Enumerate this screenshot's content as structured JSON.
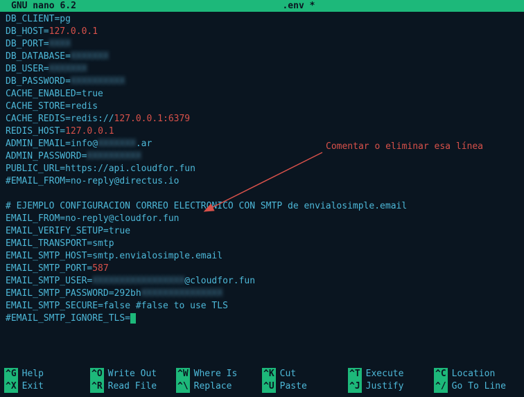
{
  "titlebar": {
    "app": "GNU nano 6.2",
    "file": ".env *"
  },
  "lines": {
    "l1_key": "DB_CLIENT",
    "l1_val": "pg",
    "l2_key": "DB_HOST",
    "l2_val": "127.0.0.1",
    "l3_key": "DB_PORT",
    "l3_blur": "XXXX",
    "l4_key": "DB_DATABASE",
    "l4_blur": "XXXXXXX",
    "l5_key": "DB_USER",
    "l5_blur": "XXXXXXX",
    "l6_key": "DB_PASSWORD",
    "l6_blur": "XXXXXXXXXX",
    "l7_key": "CACHE_ENABLED",
    "l7_val": "true",
    "l8_key": "CACHE_STORE",
    "l8_val": "redis",
    "l9_key": "CACHE_REDIS",
    "l9_val_a": "redis://",
    "l9_val_b": "127.0.0.1:6379",
    "l10_key": "REDIS_HOST",
    "l10_val": "127.0.0.1",
    "l11_key": "ADMIN_EMAIL",
    "l11_val_a": "info@",
    "l11_blur": "XXXXXXX",
    "l11_val_b": ".ar",
    "l12_key": "ADMIN_PASSWORD",
    "l12_blur": "XXXXXXXXXX",
    "l13_key": "PUBLIC_URL",
    "l13_val": "https://api.cloudfor.fun",
    "l14": "#EMAIL_FROM=no-reply@directus.io",
    "blank": " ",
    "l15": "# EJEMPLO CONFIGURACION CORREO ELECTRONICO CON SMTP de envialosimple.email",
    "l16_key": "EMAIL_FROM",
    "l16_val": "no-reply@cloudfor.fun",
    "l17_key": "EMAIL_VERIFY_SETUP",
    "l17_val": "true",
    "l18_key": "EMAIL_TRANSPORT",
    "l18_val": "smtp",
    "l19_key": "EMAIL_SMTP_HOST",
    "l19_val": "smtp.envialosimple.email",
    "l20_key": "EMAIL_SMTP_PORT",
    "l20_val": "587",
    "l21_key": "EMAIL_SMTP_USER",
    "l21_blur": "XXXXXXXXXXXXXXXXX",
    "l21_val": "@cloudfor.fun",
    "l22_key": "EMAIL_SMTP_PASSWORD",
    "l22_val_a": "292bh",
    "l22_blur": "XXXXXXXXXXXXXXX",
    "l23_key": "EMAIL_SMTP_SECURE",
    "l23_val": "false #false to use TLS",
    "l24": "#EMAIL_SMTP_IGNORE_TLS="
  },
  "annotation": "Comentar o eliminar esa línea",
  "help": {
    "r1c1_k": "^G",
    "r1c1_l": "Help",
    "r1c2_k": "^O",
    "r1c2_l": "Write Out",
    "r1c3_k": "^W",
    "r1c3_l": "Where Is",
    "r1c4_k": "^K",
    "r1c4_l": "Cut",
    "r1c5_k": "^T",
    "r1c5_l": "Execute",
    "r1c6_k": "^C",
    "r1c6_l": "Location",
    "r2c1_k": "^X",
    "r2c1_l": "Exit",
    "r2c2_k": "^R",
    "r2c2_l": "Read File",
    "r2c3_k": "^\\",
    "r2c3_l": "Replace",
    "r2c4_k": "^U",
    "r2c4_l": "Paste",
    "r2c5_k": "^J",
    "r2c5_l": "Justify",
    "r2c6_k": "^/",
    "r2c6_l": "Go To Line"
  }
}
